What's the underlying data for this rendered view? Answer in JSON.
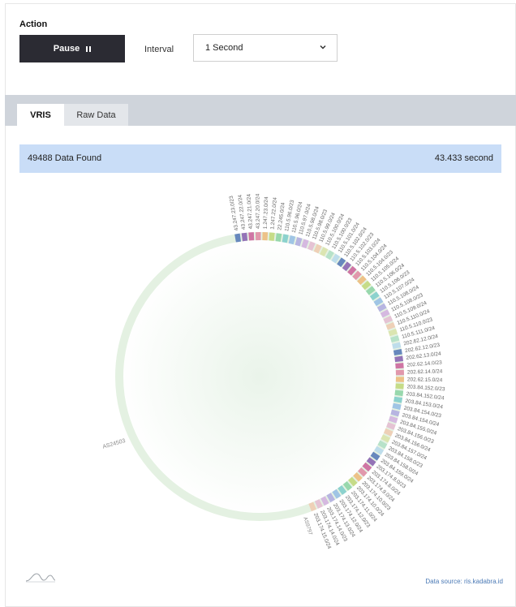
{
  "action": {
    "title": "Action",
    "pause_label": "Pause",
    "interval_label": "Interval",
    "interval_value": "1 Second"
  },
  "tabs": [
    {
      "label": "VRIS",
      "active": true
    },
    {
      "label": "Raw Data",
      "active": false
    }
  ],
  "banner": {
    "found": "49488 Data Found",
    "elapsed": "43.433 second"
  },
  "chart": {
    "center_label": "AS24503",
    "bottom_label": "AS9797",
    "prefixes": [
      "43.247.23.0/23",
      "43.247.22.0/24",
      "43.247.21.0/24",
      "43.247.20.0/24",
      "1.247.23.0/24",
      "1.247.22.0/24",
      "22.245.0/24",
      "110.5.96.0/23",
      "110.5.96.0/24",
      "110.5.97.0/24",
      "110.5.98.0/24",
      "110.5.98.0/23",
      "110.5.99.0/24",
      "110.5.100.0/24",
      "110.5.100.0/23",
      "110.5.101.0/24",
      "110.5.102.0/24",
      "110.5.102.0/23",
      "110.5.103.0/24",
      "110.5.104.0/24",
      "110.5.104.0/23",
      "110.5.105.0/24",
      "110.5.106.0/24",
      "110.5.106.0/23",
      "110.5.107.0/24",
      "110.5.108.0/24",
      "110.5.108.0/23",
      "110.5.109.0/24",
      "110.5.110.0/24",
      "110.5.110.0/23",
      "110.5.111.0/24",
      "202.62.12.0/24",
      "202.62.12.0/23",
      "202.62.13.0/24",
      "202.62.14.0/23",
      "202.62.14.0/24",
      "202.62.15.0/24",
      "203.84.152.0/23",
      "203.84.152.0/24",
      "203.84.153.0/24",
      "203.84.154.0/23",
      "203.84.154.0/24",
      "203.84.155.0/24",
      "203.84.156.0/23",
      "203.84.156.0/24",
      "203.84.157.0/24",
      "203.84.158.0/23",
      "203.84.158.0/24",
      "203.84.159.0/24",
      "203.174.8.0/23",
      "203.174.8.0/24",
      "203.174.9.0/24",
      "203.174.10.0/23",
      "203.174.10.0/24",
      "203.174.11.0/24",
      "203.174.12.0/23",
      "203.174.12.0/24",
      "203.174.13.0/24",
      "203.174.14.0/23",
      "203.174.14.0/24",
      "203.174.15.0/24"
    ]
  },
  "footer": {
    "source": "Data source: ris.kadabra.id"
  },
  "colors": {
    "button_bg": "#2b2b33",
    "tab_bar": "#cfd4db",
    "banner_bg": "#c9ddf7",
    "ring": "#e4f1e2",
    "source_link": "#4a79b5"
  }
}
